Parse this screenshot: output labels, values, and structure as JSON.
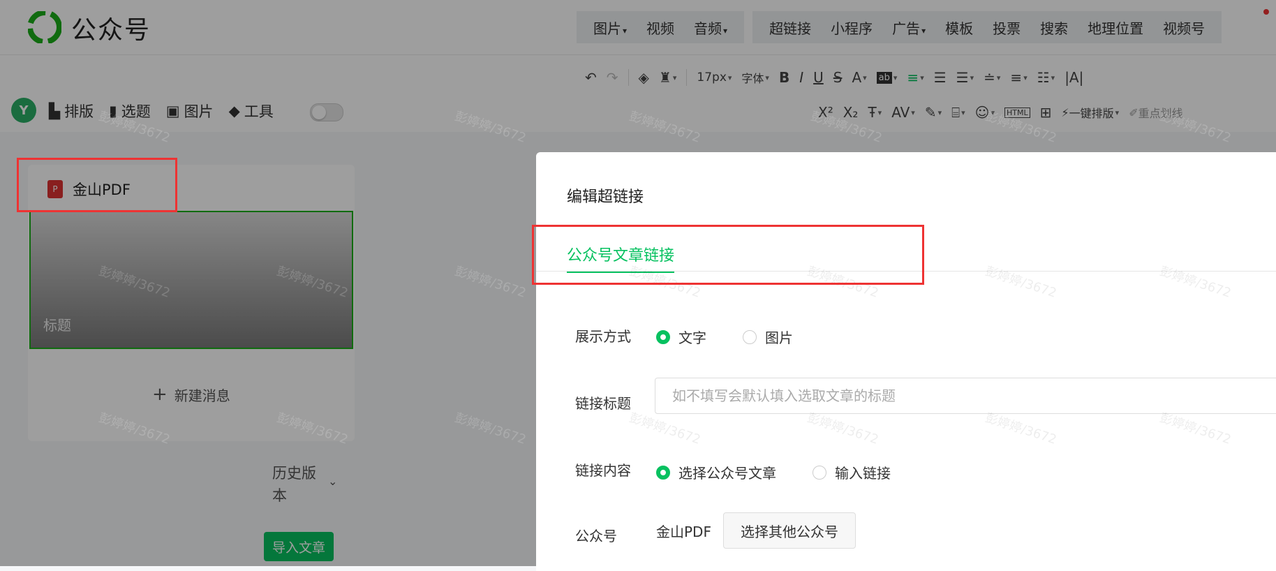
{
  "app": {
    "brand": "公众号"
  },
  "top_menu": {
    "group1": [
      {
        "label": "图片",
        "dropdown": true
      },
      {
        "label": "视频",
        "dropdown": false
      },
      {
        "label": "音频",
        "dropdown": true
      }
    ],
    "group2": [
      {
        "label": "超链接",
        "dropdown": false
      },
      {
        "label": "小程序",
        "dropdown": false
      },
      {
        "label": "广告",
        "dropdown": true
      },
      {
        "label": "模板",
        "dropdown": false
      },
      {
        "label": "投票",
        "dropdown": false
      },
      {
        "label": "搜索",
        "dropdown": false
      },
      {
        "label": "地理位置",
        "dropdown": false
      },
      {
        "label": "视频号",
        "dropdown": false
      }
    ]
  },
  "toolbar": {
    "font_size": "17px",
    "font_family": "字体",
    "one_click_layout": "一键排版",
    "highlight": "重点划线"
  },
  "left_toolbar": {
    "logo": "Y",
    "items": [
      "排版",
      "选题",
      "图片",
      "工具"
    ]
  },
  "left_panel": {
    "account": "金山PDF",
    "cover_title": "标题",
    "new_message": "新建消息",
    "history": "历史版本",
    "import_article": "导入文章"
  },
  "dialog": {
    "title": "编辑超链接",
    "tab": "公众号文章链接",
    "display_label": "展示方式",
    "display_options": [
      "文字",
      "图片"
    ],
    "link_title_label": "链接标题",
    "link_title_placeholder": "如不填写会默认填入选取文章的标题",
    "link_content_label": "链接内容",
    "link_content_options": [
      "选择公众号文章",
      "输入链接"
    ],
    "account_label": "公众号",
    "account_value": "金山PDF",
    "choose_other": "选择其他公众号"
  },
  "watermark": "彭婷婷/3672",
  "colors": {
    "accent": "#07c160",
    "highlight_box": "#ee3333"
  }
}
